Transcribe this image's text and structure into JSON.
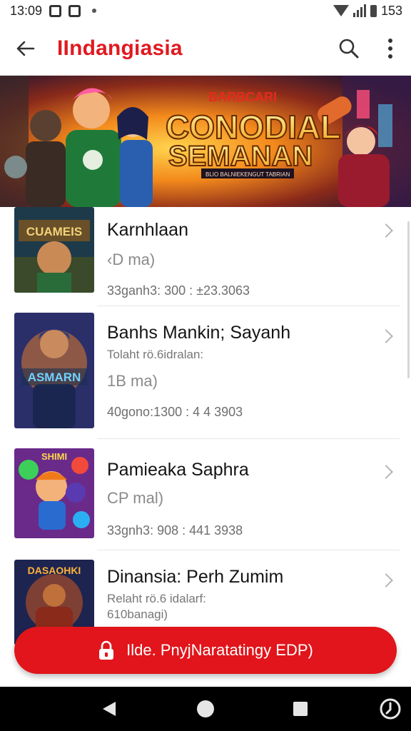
{
  "status_bar": {
    "time": "13:09",
    "battery_text": "153",
    "icons": [
      "notification-box-icon",
      "notification-image-icon",
      "dot-icon",
      "wifi-icon",
      "signal-icon",
      "battery-icon"
    ]
  },
  "app_bar": {
    "title": "IIndangiasia",
    "title_color": "#e0191f",
    "icons": [
      "back-arrow-icon",
      "search-icon",
      "more-vert-icon"
    ]
  },
  "banner": {
    "line1": "BARBCARI",
    "line2": "CONODIAL",
    "line3": "SEMANAN",
    "line4": "BLIO BALNIEKENGUT TABRIAN"
  },
  "list": {
    "items": [
      {
        "thumb_text": "CUAMEIS",
        "title": "Karnhlaan",
        "price": "‹D ma)",
        "meta": "33ganh3: 300 : ±23.3063"
      },
      {
        "thumb_text": "ASMARN",
        "title": "Banhs Mankin; Sayanh",
        "subtitle": "Tolaht rö.6idralan:",
        "price": "1B ma)",
        "meta": "40gono:1300 : 4 4 3903"
      },
      {
        "thumb_text": "SHIMI",
        "title": "Pamieaka Saphra",
        "price": "CP mal)",
        "meta": "33gnh3: 908 : 441 3938"
      },
      {
        "thumb_text": "DASAOHKI",
        "title": "Dinansia: Perh Zumim",
        "subtitle": "Relaht rö.6 idalarf:",
        "price": "610banagi)"
      }
    ]
  },
  "cta": {
    "label": "Ilde. PnyjNaratatingy EDP)",
    "color": "#e1151b",
    "icon": "lock-icon"
  },
  "nav_bar": {
    "icons": [
      "back-triangle-icon",
      "home-circle-icon",
      "recents-square-icon",
      "assistant-icon"
    ]
  }
}
